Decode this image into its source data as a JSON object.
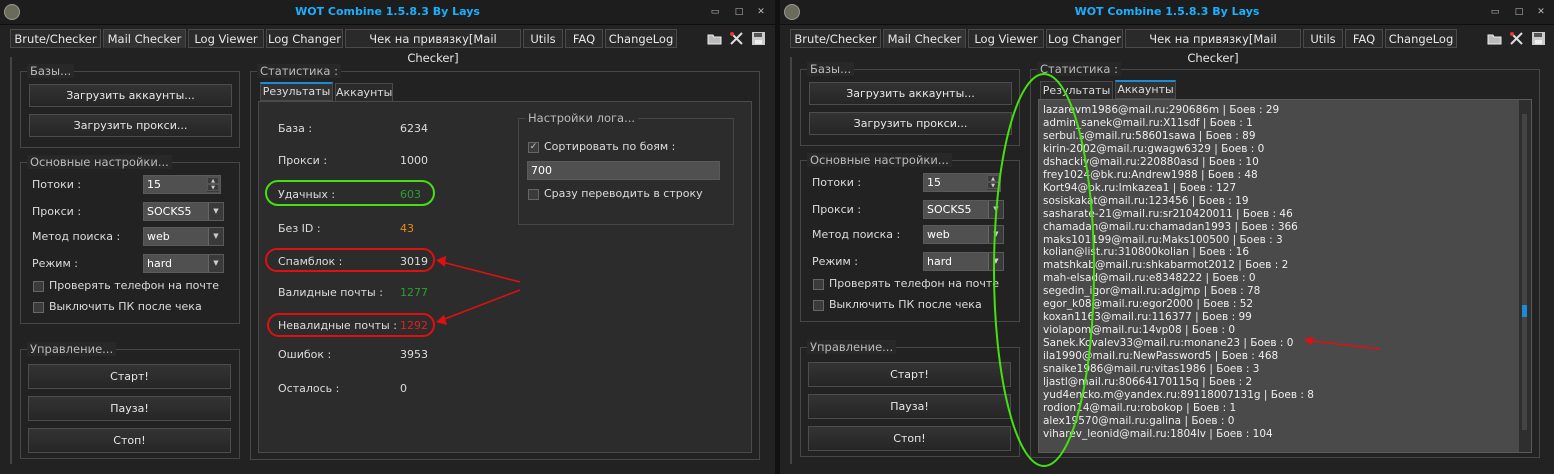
{
  "app_title": "WOT Combine 1.5.8.3 By Lays",
  "tabs": [
    "Brute/Checker",
    "Mail Checker",
    "Log  Viewer",
    "Log Changer",
    "Чек на привязку[Mail Checker]",
    "Utils",
    "FAQ",
    "ChangeLog"
  ],
  "bases": {
    "title": "Базы...",
    "load_accounts": "Загрузить аккаунты...",
    "load_proxy": "Загрузить прокси..."
  },
  "settings": {
    "title": "Основные настройки...",
    "threads_label": "Потоки :",
    "threads_value": "15",
    "proxy_label": "Прокси :",
    "proxy_value": "SOCKS5",
    "search_label": "Метод поиска :",
    "search_value": "web",
    "mode_label": "Режим  :",
    "mode_value": "hard",
    "check_phone": "Проверять телефон на почте",
    "shutdown": "Выключить ПК после чека"
  },
  "control": {
    "title": "Управление...",
    "start": "Старт!",
    "pause": "Пауза!",
    "stop": "Стоп!"
  },
  "stats": {
    "title": "Статистика :",
    "tab_results": "Результаты",
    "tab_accounts": "Аккаунты",
    "rows": [
      {
        "label": "База :",
        "value": "6234",
        "color": "#dddddd"
      },
      {
        "label": "Прокси :",
        "value": "1000",
        "color": "#dddddd"
      },
      {
        "label": "Удачных :",
        "value": "603",
        "color": "#2e9e2e"
      },
      {
        "label": "Без ID :",
        "value": "43",
        "color": "#e88a1a"
      },
      {
        "label": "Спамблок :",
        "value": "3019",
        "color": "#dddddd"
      },
      {
        "label": "Валидные почты :",
        "value": "1277",
        "color": "#2e9e2e"
      },
      {
        "label": "Невалидные почты :",
        "value": "1292",
        "color": "#e02020"
      },
      {
        "label": "Ошибок :",
        "value": "3953",
        "color": "#dddddd"
      },
      {
        "label": "Осталось :",
        "value": "0",
        "color": "#dddddd"
      }
    ]
  },
  "log_settings": {
    "title": "Настройки лога...",
    "sort_label": "Сортировать по боям :",
    "sort_value": "700",
    "convert_label": "Сразу переводить в строку"
  },
  "accounts": [
    "lazarevm1986@mail.ru:290686m | Боев : 29",
    "admin_sanek@mail.ru:X11sdf | Боев : 1",
    "serbul.s@mail.ru:58601sawa | Боев : 89",
    "kirin-2002@mail.ru:gwagw6329 | Боев : 0",
    "dshackiy@mail.ru:220880asd | Боев : 10",
    "frey1024@bk.ru:Andrew1988 | Боев : 48",
    "Kort94@bk.ru:Imkazea1 | Боев : 127",
    "sosiskakat@mail.ru:123456 | Боев : 19",
    "sasharate-21@mail.ru:sr210420011 | Боев : 46",
    "chamadan@mail.ru:chamadan1993 | Боев : 366",
    "maks101199@mail.ru:Maks100500 | Боев : 3",
    "kolian@list.ru:310800kolian | Боев : 16",
    "matshkab@mail.ru:shkabarmot2012 | Боев : 2",
    "mah-elsad@mail.ru:e8348222 | Боев : 0",
    "segedin_igor@mail.ru:adgjmp | Боев : 78",
    "egor_k08@mail.ru:egor2000 | Боев : 52",
    "koxan1163@mail.ru:116377 | Боев : 99",
    "violapom@mail.ru:14vp08 | Боев : 0",
    "Sanek.Kovalev33@mail.ru:monane23 | Боев : 0",
    "ila1990@mail.ru:NewPassword5 | Боев : 468",
    "snaike1986@mail.ru:vitas1986 | Боев : 3",
    "ljastl@mail.ru:80664170115q | Боев : 2",
    "yud4encko.m@yandex.ru:89118007131g | Боев : 8",
    "rodion14@mail.ru:robokop | Боев : 1",
    "alex19570@mail.ru:galina | Боев : 0",
    "viharev_leonid@mail.ru:1804lv | Боев : 104"
  ],
  "colors": {
    "title": "#1ab0ff",
    "green_annotation": "#44e010",
    "red_annotation": "#e01010"
  }
}
